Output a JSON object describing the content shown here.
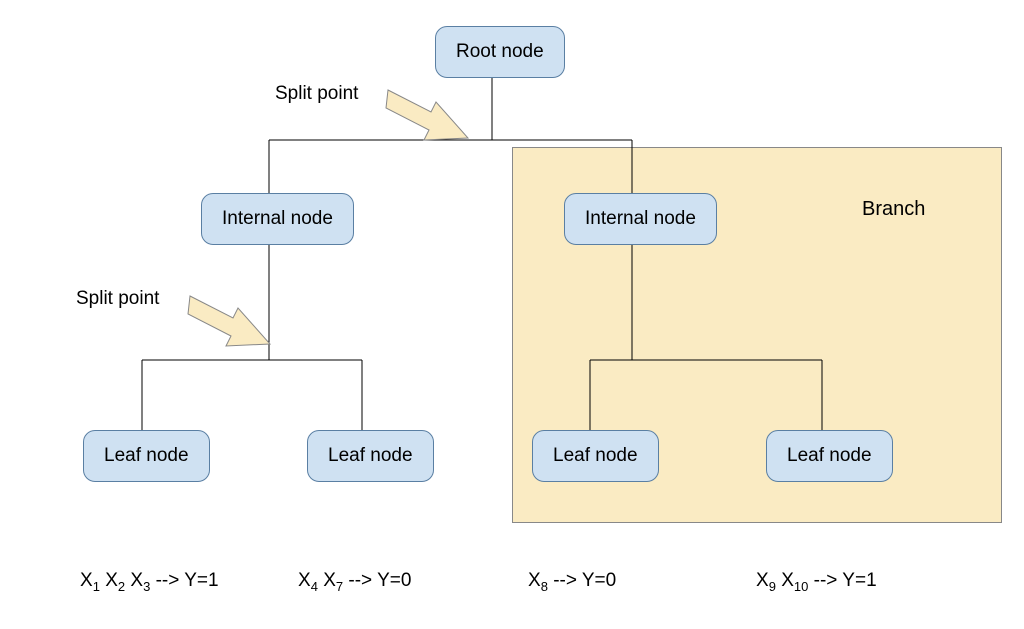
{
  "nodes": {
    "root": "Root node",
    "internal1": "Internal node",
    "internal2": "Internal node",
    "leaf1": "Leaf node",
    "leaf2": "Leaf node",
    "leaf3": "Leaf node",
    "leaf4": "Leaf node"
  },
  "labels": {
    "split1": "Split point",
    "split2": "Split point",
    "branch": "Branch"
  },
  "outputs": {
    "o1_pre": "X",
    "o1_s1": "1",
    "o1_mid1": " X",
    "o1_s2": "2",
    "o1_mid2": " X",
    "o1_s3": "3",
    "o1_post": " --> Y=1",
    "o2_pre": "X",
    "o2_s1": "4",
    "o2_mid": " X",
    "o2_s2": "7",
    "o2_post": " --> Y=0",
    "o3_pre": "X",
    "o3_s1": "8",
    "o3_post": " --> Y=0",
    "o4_pre": "X",
    "o4_s1": "9",
    "o4_mid": " X",
    "o4_s2": "10",
    "o4_post": " --> Y=1"
  }
}
